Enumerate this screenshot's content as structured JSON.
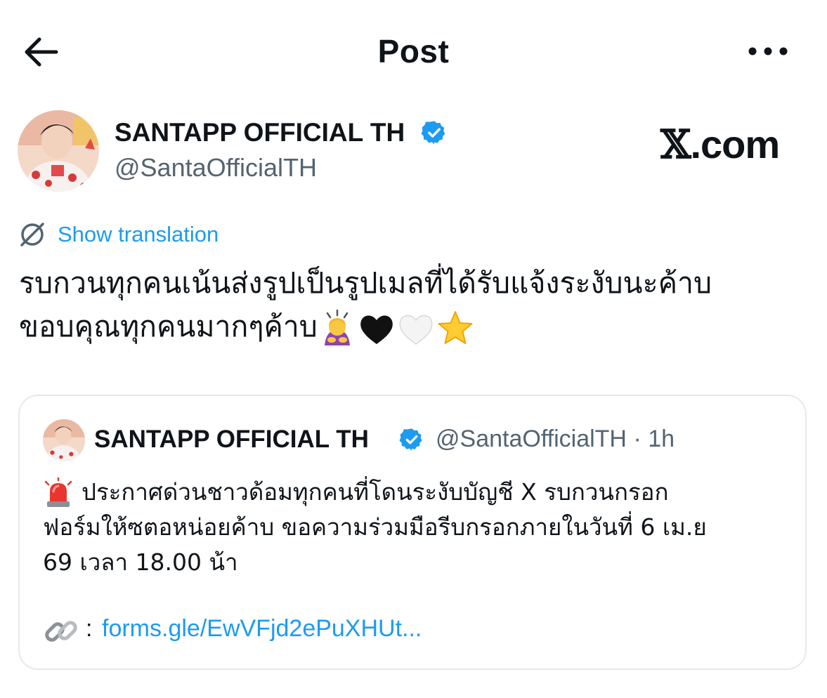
{
  "header": {
    "title": "Post",
    "back_icon": "arrow-left-icon",
    "more_icon": "more-horizontal-icon"
  },
  "author": {
    "name": "SANTAPP OFFICIAL TH",
    "handle": "@SantaOfficialTH",
    "verified_icon": "verified-badge-icon",
    "verified_color": "#1d9bf0"
  },
  "watermark": {
    "x_glyph": "𝕏",
    "suffix": ".com"
  },
  "translation": {
    "label": "Show translation",
    "icon": "translate-icon"
  },
  "body": {
    "line1": "รบกวนทุกคนเน้นส่งรูปเป็นรูปเมลที่ได้รับแจ้งระงับนะค้าบ",
    "line2": "ขอบคุณทุกคนมากๆค้าบ",
    "emojis": [
      "person-bowing-emoji",
      "black-heart-emoji",
      "white-heart-emoji",
      "star-emoji"
    ]
  },
  "quote": {
    "name": "SANTAPP OFFICIAL TH",
    "handle": "@SantaOfficialTH",
    "separator": "·",
    "time": "1h",
    "line1": "ประกาศด่วนชาวด้อมทุกคนที่โดนระงับบัญชี X รบกวนกรอก",
    "line2": "ฟอร์มให้ซตอหน่อยค้าบ ขอความร่วมมือรีบกรอกภายในวันที่ 6 เม.ย",
    "line3": "69 เวลา 18.00 น้า",
    "siren_icon": "police-light-emoji",
    "link_icon": "link-emoji",
    "link_prefix": ":",
    "link_text": "forms.gle/EwVFjd2ePuXHUt..."
  },
  "colors": {
    "accent": "#1d9bf0",
    "text_primary": "#0f1419",
    "text_secondary": "#536471",
    "border": "#e6e9eb"
  }
}
